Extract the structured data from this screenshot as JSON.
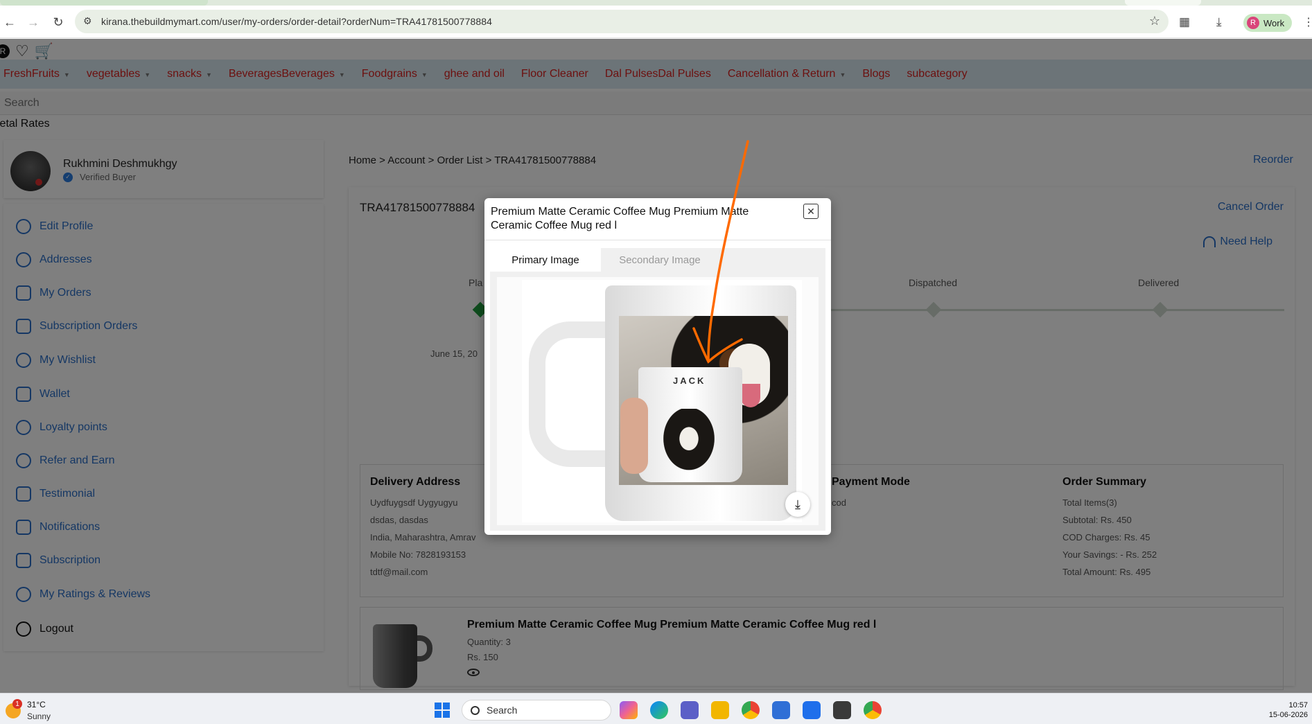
{
  "browser": {
    "url": "kirana.thebuildmymart.com/user/my-orders/order-detail?orderNum=TRA41781500778884",
    "profile_initial": "R",
    "profile_label": "Work"
  },
  "header": {
    "avatar_initial": "R",
    "menu": [
      {
        "label": "FreshFruits",
        "dropdown": true
      },
      {
        "label": "vegetables",
        "dropdown": true
      },
      {
        "label": "snacks",
        "dropdown": true
      },
      {
        "label": "BeveragesBeverages",
        "dropdown": true
      },
      {
        "label": "Foodgrains",
        "dropdown": true
      },
      {
        "label": "ghee and oil",
        "dropdown": false
      },
      {
        "label": "Floor Cleaner",
        "dropdown": false
      },
      {
        "label": "Dal PulsesDal Pulses",
        "dropdown": false
      },
      {
        "label": "Cancellation & Return",
        "dropdown": true
      },
      {
        "label": "Blogs",
        "dropdown": false
      },
      {
        "label": "subcategory",
        "dropdown": false
      }
    ],
    "search_placeholder": "Search",
    "metal_rates": "letal Rates"
  },
  "sidebar": {
    "user_name": "Rukhmini Deshmukhgy",
    "verified_label": "Verified Buyer",
    "items": [
      {
        "label": "Edit Profile"
      },
      {
        "label": "Addresses"
      },
      {
        "label": "My Orders"
      },
      {
        "label": "Subscription Orders"
      },
      {
        "label": "My Wishlist"
      },
      {
        "label": "Wallet"
      },
      {
        "label": "Loyalty points"
      },
      {
        "label": "Refer and Earn"
      },
      {
        "label": "Testimonial"
      },
      {
        "label": "Notifications"
      },
      {
        "label": "Subscription"
      },
      {
        "label": "My Ratings & Reviews"
      },
      {
        "label": "Logout"
      }
    ]
  },
  "main": {
    "breadcrumb": "Home > Account > Order List > TRA41781500778884",
    "reorder": "Reorder",
    "order_number": "TRA41781500778884",
    "cancel_order": "Cancel Order",
    "need_help": "Need Help",
    "steps": {
      "placed_partial": "Pla",
      "dispatched": "Dispatched",
      "delivered": "Delivered"
    },
    "placed_date_partial": "June 15, 20",
    "delivery_address": {
      "heading": "Delivery Address",
      "lines": [
        "Uydfuygsdf Uygyugyu",
        "dsdas, dasdas",
        "India, Maharashtra, Amrav",
        "Mobile No: 7828193153",
        "tdtf@mail.com"
      ]
    },
    "payment_mode": {
      "heading": "Payment Mode",
      "value": "cod"
    },
    "order_summary": {
      "heading": "Order Summary",
      "lines": [
        "Total Items(3)",
        "Subtotal: Rs. 450",
        "COD Charges: Rs. 45",
        "Your Savings: - Rs. 252",
        "Total Amount: Rs. 495"
      ]
    },
    "item": {
      "title": "Premium Matte Ceramic Coffee Mug Premium Matte Ceramic Coffee Mug red l",
      "quantity": "Quantity: 3",
      "price": "Rs. 150"
    }
  },
  "modal": {
    "title": "Premium Matte Ceramic Coffee Mug Premium Matte Ceramic Coffee Mug red l",
    "tab_primary": "Primary Image",
    "tab_secondary": "Secondary Image",
    "mug_text": "JACK"
  },
  "taskbar": {
    "weather_badge": "1",
    "temperature": "31°C",
    "condition": "Sunny",
    "search_label": "Search",
    "time": "10:57",
    "date": "15-06-2026"
  },
  "colors": {
    "menu_link": "#d8201e",
    "side_link": "#2a6fc9",
    "annotation_stroke": "#ff6a00",
    "step_done": "#1e9b3c"
  }
}
